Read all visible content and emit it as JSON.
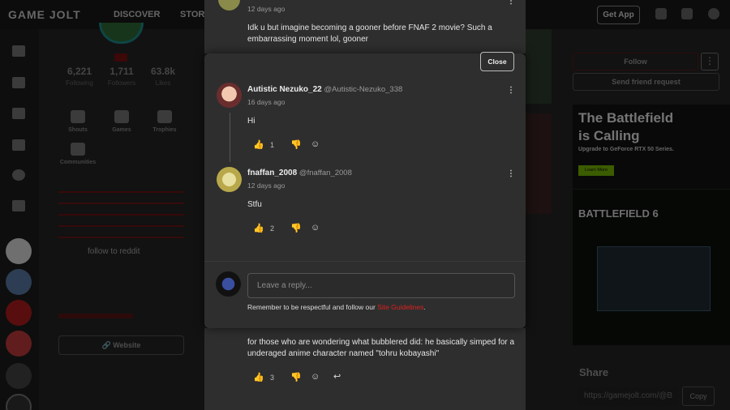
{
  "topnav": {
    "logo": "GAME JOLT",
    "discover": "DISCOVER",
    "store": "STORE",
    "get_app": "Get App"
  },
  "profile": {
    "stats": [
      {
        "value": "6,221",
        "label": "Following"
      },
      {
        "value": "1,711",
        "label": "Followers"
      },
      {
        "value": "63.8k",
        "label": "Likes"
      }
    ],
    "tiles": [
      {
        "label": "Shouts",
        "icon": "shouts-icon"
      },
      {
        "label": "Games",
        "icon": "gamepad-icon"
      },
      {
        "label": "Trophies",
        "icon": "trophy-icon"
      },
      {
        "label": "Communities",
        "icon": "communities-icon"
      }
    ],
    "bio_tail": "follow to reddit",
    "website_label": "Website"
  },
  "right": {
    "follow": "Follow",
    "more": "⋮",
    "friend_request": "Send friend request",
    "ad_title_line1": "The Battlefield",
    "ad_title_line2": "is Calling",
    "ad_sub": "Upgrade to GeForce RTX 50 Series.",
    "ad_learn": "Learn More",
    "ad2_title": "BATTLEFIELD 6",
    "share_heading": "Share",
    "share_url": "https://gamejolt.com/@B",
    "copy": "Copy"
  },
  "background_comment": {
    "date": "12 days ago",
    "text": "Idk u but imagine becoming a gooner before FNAF 2 movie? Such a embarrassing moment lol, gooner"
  },
  "bottom_comment": {
    "text": "for those who are wondering what bubblered did: he basically simped for a underaged anime character named \"tohru kobayashi\"",
    "likes": "3"
  },
  "modal": {
    "close": "Close",
    "comments": [
      {
        "name": "Autistic Nezuko_22",
        "handle": "@Autistic-Nezuko_338",
        "date": "16 days ago",
        "text": "Hi",
        "likes": "1"
      },
      {
        "name": "fnaffan_2008",
        "handle": "@fnaffan_2008",
        "date": "12 days ago",
        "text": "Stfu",
        "likes": "2"
      }
    ],
    "reply_placeholder": "Leave a reply...",
    "remember_prefix": "Remember to be respectful and follow our ",
    "remember_link": "Site Guidelines",
    "remember_suffix": "."
  },
  "colors": {
    "accent_red": "#e01f1f",
    "modal_bg": "#2e2e2e"
  }
}
